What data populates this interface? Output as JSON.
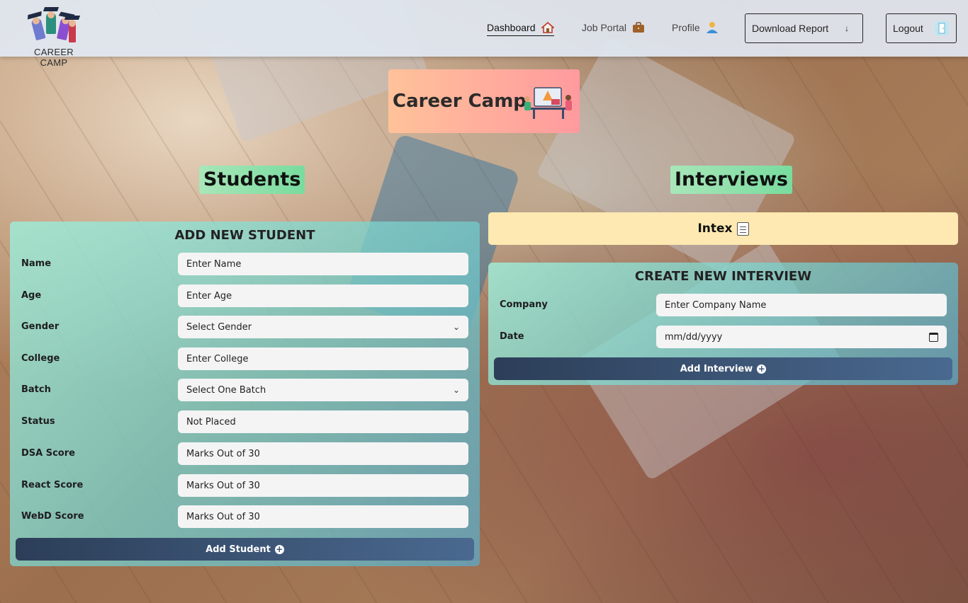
{
  "brand": {
    "name": "CAREER CAMP"
  },
  "nav": {
    "dashboard": "Dashboard",
    "job_portal": "Job Portal",
    "profile": "Profile",
    "download_report": "Download Report",
    "logout": "Logout"
  },
  "hero": {
    "title": "Career Camp"
  },
  "sections": {
    "students": "Students",
    "interviews": "Interviews"
  },
  "student_form": {
    "heading": "ADD NEW STUDENT",
    "fields": [
      {
        "label": "Name",
        "placeholder": "Enter Name"
      },
      {
        "label": "Age",
        "placeholder": "Enter Age"
      },
      {
        "label": "Gender",
        "value": "Select Gender"
      },
      {
        "label": "College",
        "placeholder": "Enter College"
      },
      {
        "label": "Batch",
        "value": "Select One Batch"
      },
      {
        "label": "Status",
        "value": "Not Placed"
      },
      {
        "label": "DSA Score",
        "placeholder": "Marks Out of 30"
      },
      {
        "label": "React Score",
        "placeholder": "Marks Out of 30"
      },
      {
        "label": "WebD Score",
        "placeholder": "Marks Out of 30"
      }
    ],
    "submit": "Add Student"
  },
  "intex": {
    "label": "Intex"
  },
  "interview_form": {
    "heading": "CREATE NEW INTERVIEW",
    "fields": [
      {
        "label": "Company",
        "placeholder": "Enter Company Name"
      },
      {
        "label": "Date",
        "placeholder": "mm/dd/yyyy"
      }
    ],
    "submit": "Add Interview"
  },
  "colors": {
    "hero_gradient": [
      "#ffc29a",
      "#ff9a9e"
    ],
    "section_title_bg": [
      "#a9e6b9",
      "#78dc9e"
    ],
    "intex_bg": "#fde9b1",
    "button_gradient": [
      "#2c3e58",
      "#4a6990"
    ]
  },
  "icons": {
    "dashboard": "house-icon",
    "job_portal": "briefcase-icon",
    "profile": "user-icon",
    "download_report": "arrow-down-icon",
    "logout": "door-icon",
    "intex": "memo-icon",
    "submit": "plus-circle-icon"
  }
}
